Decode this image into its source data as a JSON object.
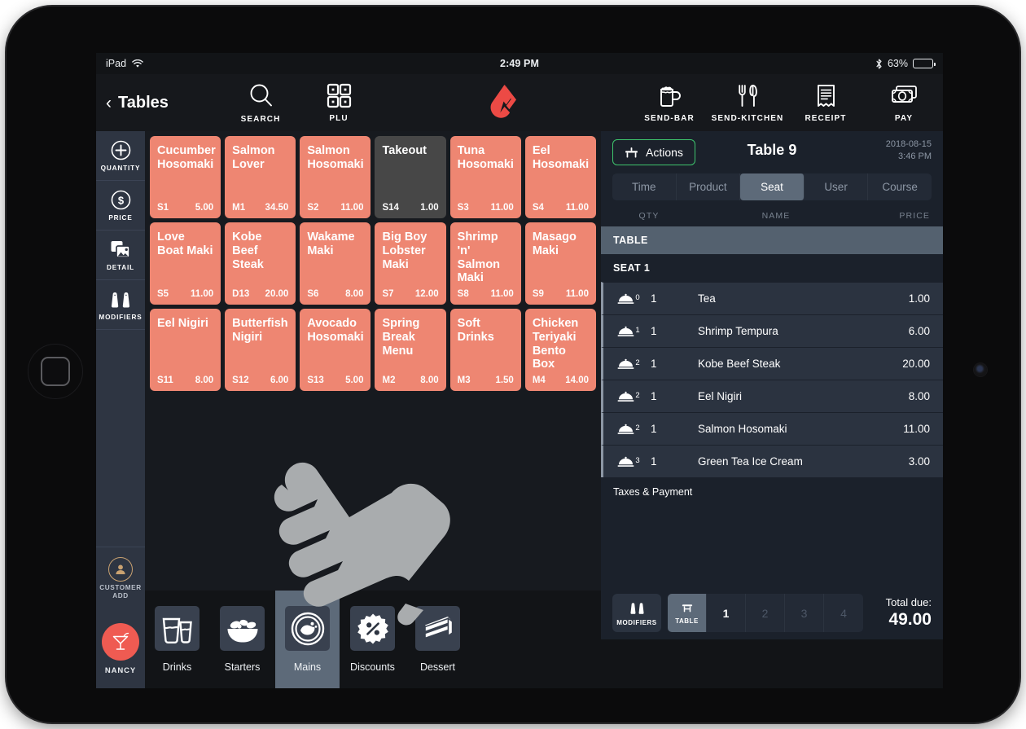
{
  "status_bar": {
    "device": "iPad",
    "wifi_icon": "wifi-icon",
    "time": "2:49 PM",
    "bluetooth_icon": "bluetooth-icon",
    "battery_percent": "63%"
  },
  "top_nav": {
    "back_label": "Tables",
    "brand_logo": "lightspeed-flame-logo",
    "brand_color": "#ec4a45",
    "buttons": [
      {
        "label": "SEARCH",
        "icon": "search-icon"
      },
      {
        "label": "PLU",
        "icon": "grid-icon"
      },
      {
        "label": "SEND-BAR",
        "icon": "beer-mug-icon"
      },
      {
        "label": "SEND-KITCHEN",
        "icon": "fork-knife-icon"
      },
      {
        "label": "RECEIPT",
        "icon": "receipt-icon"
      },
      {
        "label": "PAY",
        "icon": "banknote-icon"
      }
    ]
  },
  "tool_rail": {
    "items": [
      {
        "label": "QUANTITY",
        "icon": "plus-circle-icon"
      },
      {
        "label": "PRICE",
        "icon": "dollar-circle-icon"
      },
      {
        "label": "DETAIL",
        "icon": "photos-icon"
      },
      {
        "label": "MODIFIERS",
        "icon": "salt-pepper-icon"
      }
    ],
    "customer_add": {
      "line1": "CUSTOMER",
      "line2": "ADD",
      "icon": "person-icon"
    },
    "user": {
      "name": "NANCY",
      "icon": "cocktail-icon",
      "color": "#ef5b52"
    }
  },
  "product_grid": {
    "tile_color": "#ee8672",
    "tile_color_alt": "#474747",
    "tiles": [
      {
        "name": "Cucumber Hosomaki",
        "code": "S1",
        "price": "5.00",
        "alt": false
      },
      {
        "name": "Salmon Lover",
        "code": "M1",
        "price": "34.50",
        "alt": false
      },
      {
        "name": "Salmon Hosomaki",
        "code": "S2",
        "price": "11.00",
        "alt": false
      },
      {
        "name": "Takeout",
        "code": "S14",
        "price": "1.00",
        "alt": true
      },
      {
        "name": "Tuna Hosomaki",
        "code": "S3",
        "price": "11.00",
        "alt": false
      },
      {
        "name": "Eel Hosomaki",
        "code": "S4",
        "price": "11.00",
        "alt": false
      },
      {
        "name": "Love Boat Maki",
        "code": "S5",
        "price": "11.00",
        "alt": false
      },
      {
        "name": "Kobe Beef Steak",
        "code": "D13",
        "price": "20.00",
        "alt": false
      },
      {
        "name": "Wakame Maki",
        "code": "S6",
        "price": "8.00",
        "alt": false
      },
      {
        "name": "Big Boy Lobster Maki",
        "code": "S7",
        "price": "12.00",
        "alt": false
      },
      {
        "name": "Shrimp 'n' Salmon Maki",
        "code": "S8",
        "price": "11.00",
        "alt": false
      },
      {
        "name": "Masago Maki",
        "code": "S9",
        "price": "11.00",
        "alt": false
      },
      {
        "name": "Eel Nigiri",
        "code": "S11",
        "price": "8.00",
        "alt": false
      },
      {
        "name": "Butterfish Nigiri",
        "code": "S12",
        "price": "6.00",
        "alt": false
      },
      {
        "name": "Avocado Hosomaki",
        "code": "S13",
        "price": "5.00",
        "alt": false
      },
      {
        "name": "Spring Break Menu",
        "code": "M2",
        "price": "8.00",
        "alt": false
      },
      {
        "name": "Soft Drinks",
        "code": "M3",
        "price": "1.50",
        "alt": false
      },
      {
        "name": "Chicken Teriyaki Bento Box",
        "code": "M4",
        "price": "14.00",
        "alt": false
      }
    ]
  },
  "categories": [
    {
      "label": "Drinks",
      "icon": "drinks-glasses-icon",
      "active": false
    },
    {
      "label": "Starters",
      "icon": "salad-bowl-icon",
      "active": false
    },
    {
      "label": "Mains",
      "icon": "plate-meal-icon",
      "active": true
    },
    {
      "label": "Discounts",
      "icon": "percent-badge-icon",
      "active": false
    },
    {
      "label": "Dessert",
      "icon": "cake-slice-icon",
      "active": false
    }
  ],
  "order_panel": {
    "actions_label": "Actions",
    "actions_icon": "table-furniture-icon",
    "actions_border_color": "#3ec46d",
    "title": "Table 9",
    "date": "2018-08-15",
    "time": "3:46 PM",
    "tabs": [
      {
        "label": "Time",
        "active": false
      },
      {
        "label": "Product",
        "active": false
      },
      {
        "label": "Seat",
        "active": true
      },
      {
        "label": "User",
        "active": false
      },
      {
        "label": "Course",
        "active": false
      }
    ],
    "columns": {
      "qty": "QTY",
      "name": "NAME",
      "price": "PRICE"
    },
    "group_table": "TABLE",
    "group_seat": "SEAT 1",
    "items": [
      {
        "course": "0",
        "qty": "1",
        "name": "Tea",
        "price": "1.00"
      },
      {
        "course": "1",
        "qty": "1",
        "name": "Shrimp Tempura",
        "price": "6.00"
      },
      {
        "course": "2",
        "qty": "1",
        "name": "Kobe Beef Steak",
        "price": "20.00"
      },
      {
        "course": "2",
        "qty": "1",
        "name": "Eel Nigiri",
        "price": "8.00"
      },
      {
        "course": "2",
        "qty": "1",
        "name": "Salmon Hosomaki",
        "price": "11.00"
      },
      {
        "course": "3",
        "qty": "1",
        "name": "Green Tea Ice Cream",
        "price": "3.00"
      }
    ],
    "taxes_label": "Taxes & Payment",
    "footer": {
      "modifiers_label": "MODIFIERS",
      "modifiers_icon": "salt-pepper-icon",
      "table_label": "TABLE",
      "table_icon": "stool-icon",
      "seats": [
        {
          "label": "1",
          "current": true
        },
        {
          "label": "2",
          "current": false
        },
        {
          "label": "3",
          "current": false
        },
        {
          "label": "4",
          "current": false
        }
      ],
      "total_label": "Total due:",
      "total_amount": "49.00"
    }
  }
}
